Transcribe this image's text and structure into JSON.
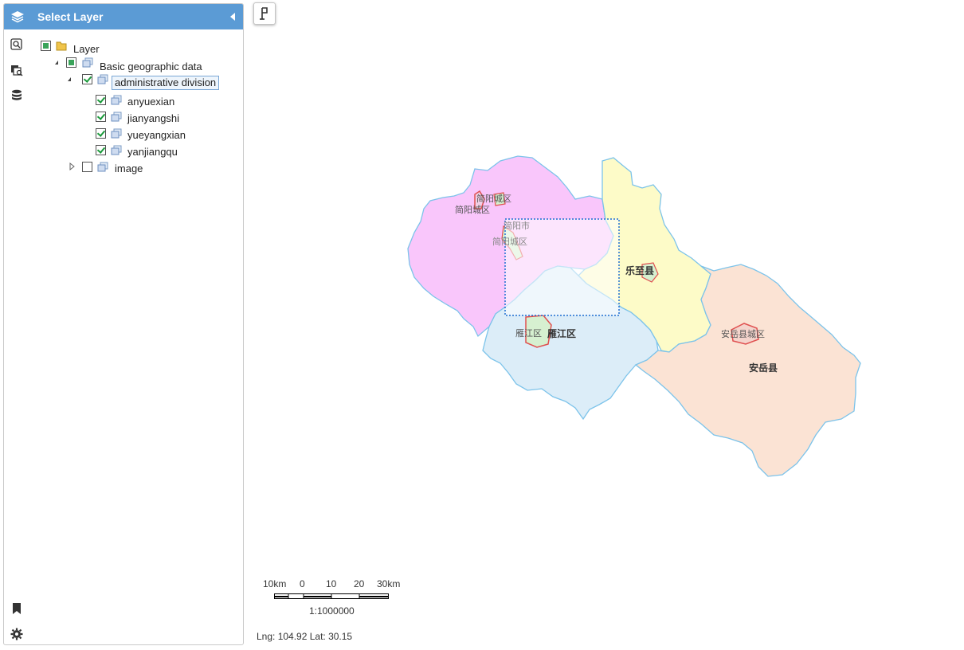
{
  "panel": {
    "title": "Select Layer",
    "tree": {
      "root": "Layer",
      "group": "Basic geographic data",
      "selected": "administrative division",
      "layers": [
        "anyuexian",
        "jianyangshi",
        "yueyangxian",
        "yanjiangqu"
      ],
      "other": "image"
    }
  },
  "map": {
    "labels": {
      "jianyang_a": "简阳城区",
      "jianyang_b": "简阳城区",
      "jianyang_city": "简阳市",
      "jianyang_c": "简阳城区",
      "lezhi": "乐至县",
      "yanjiang_a": "雁江区",
      "yanjiang_b": "雁江区",
      "anyue_city": "安岳县城区",
      "anyue": "安岳县"
    },
    "colors": {
      "jianyang": "#f9c6fb",
      "lezhi": "#fdfbc8",
      "yanjiang": "#dcedf8",
      "anyue": "#fbe3d4",
      "border": "#7cc3ea",
      "city_border": "#e05050"
    }
  },
  "scale": {
    "ticks": [
      "10km",
      "0",
      "10",
      "20",
      "30km"
    ],
    "ratio": "1:1000000"
  },
  "status": {
    "coords": "Lng: 104.92 Lat: 30.15"
  }
}
